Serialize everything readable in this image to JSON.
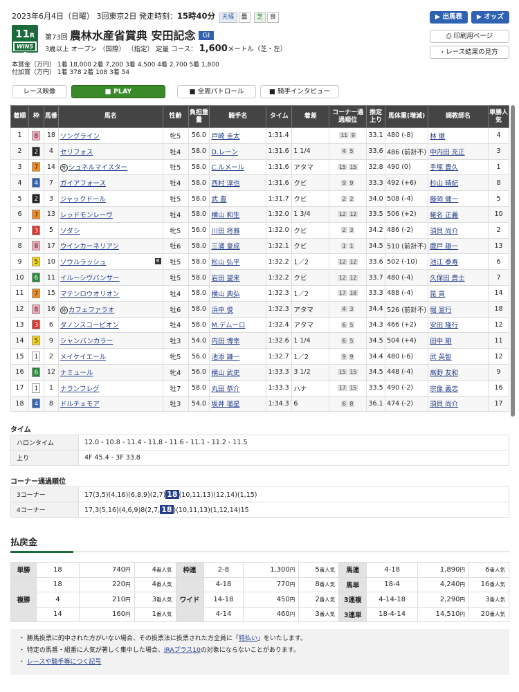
{
  "header": {
    "date": "2023年6月4日（日曜） 3回東京2日 発走時刻：",
    "post_time": "15時40分",
    "weather_label": "天候",
    "weather": "曇",
    "track_label": "芝",
    "track": "良"
  },
  "race": {
    "number": "11",
    "r": "R",
    "win5": "WIN5 5",
    "kai": "第73回",
    "name": "農林水産省賞典 安田記念",
    "grade": "GI",
    "conditions": "3歳以上 オープン （国際） （指定） 定量 コース：",
    "distance": "1,600",
    "dist_suffix": "メートル（芝・左）"
  },
  "prize_text": "本賞金（万円） 1着 18,000 2着 7,200 3着 4,500 4着 2,700 5着 1,800\n付加賞（万円） 1着 378 2着 108 3着 54",
  "buttons": {
    "shutsuba": "出馬表",
    "odds": "オッズ",
    "print": "印刷用ページ",
    "howto": "レース結果の見方",
    "video": "レース映像",
    "play": "PLAY",
    "patrol": "全周パトロール",
    "interview": "騎手インタビュー"
  },
  "columns": [
    "着順",
    "枠",
    "馬番",
    "馬名",
    "性齢",
    "負担重量",
    "騎手名",
    "タイム",
    "着差",
    "コーナー通過順位",
    "推定上り",
    "馬体重(増減)",
    "調教師名",
    "単勝人気"
  ],
  "rows": [
    {
      "rank": "1",
      "waku": "8",
      "num": "18",
      "name": "ソングライン",
      "mark": "",
      "blinker": false,
      "sex": "牝5",
      "wt": "56.0",
      "jockey": "戸崎 圭太",
      "time": "1:31.4",
      "margin": "",
      "c1": "11",
      "c2": "9",
      "up": "33.1",
      "body": "480 (-8)",
      "trainer": "林 徹",
      "pop": "4"
    },
    {
      "rank": "2",
      "waku": "2",
      "num": "4",
      "name": "セリフォス",
      "mark": "",
      "blinker": false,
      "sex": "牡4",
      "wt": "58.0",
      "jockey": "D.レーン",
      "time": "1:31.6",
      "margin": "1 1/4",
      "c1": "4",
      "c2": "5",
      "up": "33.6",
      "body": "486 (前計不)",
      "trainer": "中内田 充正",
      "pop": "3"
    },
    {
      "rank": "3",
      "waku": "7",
      "num": "14",
      "name": "シュネルマイスター",
      "mark": "外",
      "blinker": false,
      "sex": "牡5",
      "wt": "58.0",
      "jockey": "C.ルメール",
      "time": "1:31.6",
      "margin": "アタマ",
      "c1": "15",
      "c2": "15",
      "up": "32.8",
      "body": "490 (0)",
      "trainer": "手塚 貴久",
      "pop": "1"
    },
    {
      "rank": "4",
      "waku": "4",
      "num": "7",
      "name": "ガイアフォース",
      "mark": "",
      "blinker": false,
      "sex": "牡4",
      "wt": "58.0",
      "jockey": "西村 淳也",
      "time": "1:31.6",
      "margin": "クビ",
      "c1": "9",
      "c2": "9",
      "up": "33.3",
      "body": "492 (+6)",
      "trainer": "杉山 晴紀",
      "pop": "8"
    },
    {
      "rank": "5",
      "waku": "2",
      "num": "3",
      "name": "ジャックドール",
      "mark": "",
      "blinker": false,
      "sex": "牡5",
      "wt": "58.0",
      "jockey": "武 豊",
      "time": "1:31.7",
      "margin": "クビ",
      "c1": "2",
      "c2": "2",
      "up": "34.0",
      "body": "508 (-4)",
      "trainer": "藤岡 健一",
      "pop": "5"
    },
    {
      "rank": "6",
      "waku": "7",
      "num": "13",
      "name": "レッドモンレーヴ",
      "mark": "",
      "blinker": false,
      "sex": "牡4",
      "wt": "58.0",
      "jockey": "横山 和生",
      "time": "1:32.0",
      "margin": "1 3/4",
      "c1": "12",
      "c2": "12",
      "up": "33.5",
      "body": "506 (+2)",
      "trainer": "蛯名 正義",
      "pop": "10"
    },
    {
      "rank": "7",
      "waku": "3",
      "num": "5",
      "name": "ソダシ",
      "mark": "",
      "blinker": false,
      "sex": "牝5",
      "wt": "56.0",
      "jockey": "川田 将雅",
      "time": "1:32.0",
      "margin": "クビ",
      "c1": "2",
      "c2": "3",
      "up": "34.2",
      "body": "486 (-2)",
      "trainer": "須貝 尚介",
      "pop": "2"
    },
    {
      "rank": "8",
      "waku": "8",
      "num": "17",
      "name": "ウインカーネリアン",
      "mark": "",
      "blinker": false,
      "sex": "牡6",
      "wt": "58.0",
      "jockey": "三浦 皇成",
      "time": "1:32.1",
      "margin": "クビ",
      "c1": "1",
      "c2": "1",
      "up": "34.5",
      "body": "510 (前計不)",
      "trainer": "鹿戸 雄一",
      "pop": "13"
    },
    {
      "rank": "9",
      "waku": "5",
      "num": "10",
      "name": "ソウルラッシュ",
      "mark": "",
      "blinker": true,
      "sex": "牡5",
      "wt": "58.0",
      "jockey": "松山 弘平",
      "time": "1:32.2",
      "margin": "1／2",
      "c1": "12",
      "c2": "12",
      "up": "33.6",
      "body": "502 (-10)",
      "trainer": "池江 泰寿",
      "pop": "6"
    },
    {
      "rank": "10",
      "waku": "6",
      "num": "11",
      "name": "イルーシヴパンサー",
      "mark": "",
      "blinker": false,
      "sex": "牡5",
      "wt": "58.0",
      "jockey": "岩田 望来",
      "time": "1:32.2",
      "margin": "クビ",
      "c1": "12",
      "c2": "12",
      "up": "33.7",
      "body": "480 (-4)",
      "trainer": "久保田 貴士",
      "pop": "7"
    },
    {
      "rank": "11",
      "waku": "7",
      "num": "15",
      "name": "マテンロウオリオン",
      "mark": "",
      "blinker": false,
      "sex": "牡4",
      "wt": "58.0",
      "jockey": "横山 典弘",
      "time": "1:32.3",
      "margin": "1／2",
      "c1": "17",
      "c2": "18",
      "up": "33.3",
      "body": "488 (-4)",
      "trainer": "昆 貢",
      "pop": "14"
    },
    {
      "rank": "12",
      "waku": "8",
      "num": "16",
      "name": "カフェファラオ",
      "mark": "外",
      "blinker": false,
      "sex": "牡6",
      "wt": "58.0",
      "jockey": "浜中 俊",
      "time": "1:32.3",
      "margin": "アタマ",
      "c1": "4",
      "c2": "3",
      "up": "34.4",
      "body": "526 (前計不)",
      "trainer": "堀 宣行",
      "pop": "18"
    },
    {
      "rank": "13",
      "waku": "3",
      "num": "6",
      "name": "ダノンスコーピオン",
      "mark": "",
      "blinker": false,
      "sex": "牡4",
      "wt": "58.0",
      "jockey": "M.デムーロ",
      "time": "1:32.4",
      "margin": "アタマ",
      "c1": "6",
      "c2": "5",
      "up": "34.3",
      "body": "466 (+2)",
      "trainer": "安田 隆行",
      "pop": "12"
    },
    {
      "rank": "14",
      "waku": "5",
      "num": "9",
      "name": "シャンパンカラー",
      "mark": "",
      "blinker": false,
      "sex": "牡3",
      "wt": "54.0",
      "jockey": "内田 博幸",
      "time": "1:32.6",
      "margin": "1 1/4",
      "c1": "6",
      "c2": "5",
      "up": "34.5",
      "body": "504 (+4)",
      "trainer": "田中 剛",
      "pop": "11"
    },
    {
      "rank": "15",
      "waku": "1",
      "num": "2",
      "name": "メイケイエール",
      "mark": "",
      "blinker": false,
      "sex": "牝5",
      "wt": "56.0",
      "jockey": "池添 謙一",
      "time": "1:32.7",
      "margin": "1／2",
      "c1": "9",
      "c2": "9",
      "up": "34.4",
      "body": "480 (-6)",
      "trainer": "武 英智",
      "pop": "12"
    },
    {
      "rank": "16",
      "waku": "6",
      "num": "12",
      "name": "ナミュール",
      "mark": "",
      "blinker": false,
      "sex": "牝4",
      "wt": "56.0",
      "jockey": "横山 武史",
      "time": "1:33.3",
      "margin": "3 1/2",
      "c1": "15",
      "c2": "15",
      "up": "34.5",
      "body": "448 (-4)",
      "trainer": "高野 友和",
      "pop": "9"
    },
    {
      "rank": "17",
      "waku": "1",
      "num": "1",
      "name": "ナランフレグ",
      "mark": "",
      "blinker": false,
      "sex": "牡7",
      "wt": "58.0",
      "jockey": "丸田 恭介",
      "time": "1:33.3",
      "margin": "ハナ",
      "c1": "17",
      "c2": "15",
      "up": "33.5",
      "body": "490 (-2)",
      "trainer": "宗像 義忠",
      "pop": "16"
    },
    {
      "rank": "18",
      "waku": "4",
      "num": "8",
      "name": "ドルチェモア",
      "mark": "",
      "blinker": false,
      "sex": "牡3",
      "wt": "54.0",
      "jockey": "坂井 瑠星",
      "time": "1:34.3",
      "margin": "6",
      "c1": "6",
      "c2": "8",
      "up": "36.1",
      "body": "474 (-2)",
      "trainer": "須貝 尚介",
      "pop": "17"
    }
  ],
  "time_section": {
    "title": "タイム",
    "furlong_label": "ハロンタイム",
    "furlong": "12.0 - 10.8 - 11.4 - 11.8 - 11.6 - 11.1 - 11.2 - 11.5",
    "agari_label": "上り",
    "agari": "4F 45.4 - 3F 33.8"
  },
  "corner_section": {
    "title": "コーナー通過順位",
    "c3_label": "3コーナー",
    "c3_pre": "17(3,5)(4,16)(6,8,9)(2,7)",
    "c3_hl": "18",
    "c3_post": "(10,11,13)(12,14)(1,15)",
    "c4_label": "4コーナー",
    "c4_pre": "17,3(5,16)(4,6,9)8(2,7,",
    "c4_hl": "18",
    "c4_post": ")(10,11,13)(1,12,14)15"
  },
  "payout": {
    "title": "払戻金",
    "yen": "円",
    "ninki": "番人気",
    "tansho": {
      "label": "単勝",
      "num": "18",
      "amount": "740",
      "pop": "4"
    },
    "fukusho": {
      "label": "複勝",
      "rows": [
        {
          "num": "18",
          "amount": "220",
          "pop": "4"
        },
        {
          "num": "4",
          "amount": "210",
          "pop": "3"
        },
        {
          "num": "14",
          "amount": "160",
          "pop": "1"
        }
      ]
    },
    "wakuren": {
      "label": "枠連",
      "num": "2-8",
      "amount": "1,300",
      "pop": "5"
    },
    "wide": {
      "label": "ワイド",
      "rows": [
        {
          "num": "4-18",
          "amount": "770",
          "pop": "8"
        },
        {
          "num": "14-18",
          "amount": "450",
          "pop": "2"
        },
        {
          "num": "4-14",
          "amount": "460",
          "pop": "3"
        }
      ]
    },
    "umaren": {
      "label": "馬連",
      "num": "4-18",
      "amount": "1,890",
      "pop": "6"
    },
    "umatan": {
      "label": "馬単",
      "num": "18-4",
      "amount": "4,240",
      "pop": "16"
    },
    "sanrenpuku": {
      "label": "3連複",
      "num": "4-14-18",
      "amount": "2,290",
      "pop": "3"
    },
    "sanrentan": {
      "label": "3連単",
      "num": "18-4-14",
      "amount": "14,510",
      "pop": "20"
    }
  },
  "notes": {
    "n1_pre": "・ 勝馬投票に的中された方がいない場合、その投票法に投票された方全員に「",
    "n1_link": "特払い",
    "n1_post": "」をいたします。",
    "n2_pre": "・ 特定の馬番・組番に人気が著しく集中した場合、",
    "n2_link": "JRAプラス10",
    "n2_post": "の対象にならないことがあります。",
    "n3_link": "レースや騎手等につく記号"
  },
  "colors": {
    "w1": "#ffffff",
    "w2": "#222222",
    "w3": "#d9362c",
    "w4": "#2f62b0",
    "w5": "#f2d21b",
    "w6": "#2a8a3a",
    "w7": "#f08a1c",
    "w8": "#f4a7b9"
  }
}
